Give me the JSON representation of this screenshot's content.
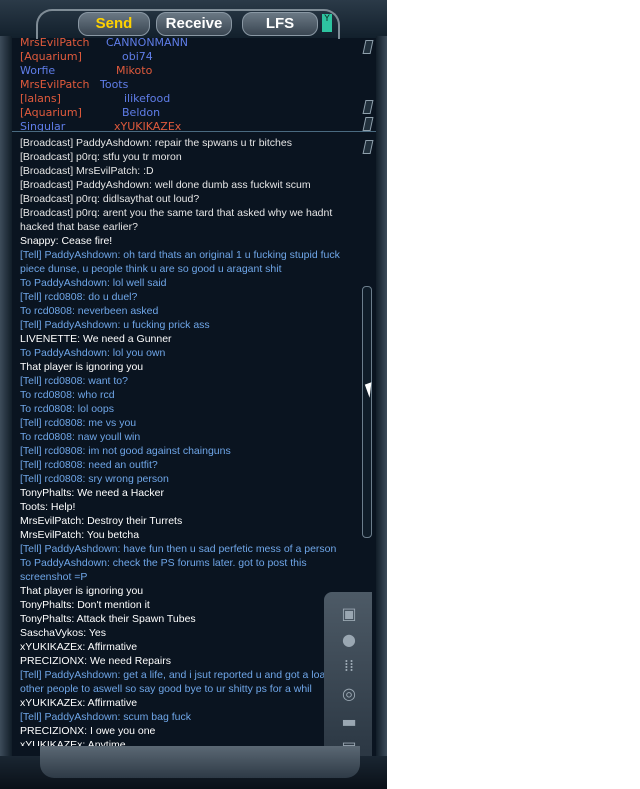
{
  "tabs": [
    {
      "label": "Send",
      "active": true
    },
    {
      "label": "Receive",
      "active": false
    },
    {
      "label": "LFS",
      "active": false
    }
  ],
  "tab_extra_glyph": "Y",
  "roster": [
    {
      "name1": "MrsEvilPatch",
      "name2": "CANNONMANN",
      "c1": "#e05a3c",
      "c2": "#5f7de8"
    },
    {
      "name1": "[Aquarium]",
      "name2": "obi74",
      "c1": "#e05a3c",
      "c2": "#5f7de8"
    },
    {
      "name1": "Worfie",
      "name2": "Mikoto",
      "c1": "#5f7de8",
      "c2": "#e05a3c"
    },
    {
      "name1": "MrsEvilPatch",
      "name2": "Toots",
      "c1": "#e05a3c",
      "c2": "#5f7de8"
    },
    {
      "name1": "[lalans]",
      "name2": "ilikefood",
      "c1": "#e05a3c",
      "c2": "#5f7de8"
    },
    {
      "name1": "[Aquarium]",
      "name2": "Beldon",
      "c1": "#e05a3c",
      "c2": "#5f7de8"
    },
    {
      "name1": "Singular",
      "name2": "xYUKIKAZEx",
      "c1": "#5f7de8",
      "c2": "#e05a3c"
    }
  ],
  "chat": [
    {
      "text": "[Broadcast] PaddyAshdown: repair the spwans u tr bitches",
      "color": "#e6e6e6"
    },
    {
      "text": "[Broadcast] p0rq: stfu you tr moron",
      "color": "#e6e6e6"
    },
    {
      "text": "[Broadcast] MrsEvilPatch: :D",
      "color": "#e6e6e6"
    },
    {
      "text": "[Broadcast] PaddyAshdown: well done dumb ass fuckwit scum",
      "color": "#e6e6e6"
    },
    {
      "text": "[Broadcast] p0rq: didlsaythat out loud?",
      "color": "#e6e6e6"
    },
    {
      "text": "[Broadcast] p0rq: arent you the same tard that asked why we hadnt hacked that base earlier?",
      "color": "#e6e6e6"
    },
    {
      "text": "Snappy: Cease fire!",
      "color": "#ffffff"
    },
    {
      "text": "[Tell] PaddyAshdown: oh tard thats an original 1 u fucking stupid fuck piece dunse, u people think u are so good u aragant shit",
      "color": "#6fa6e8"
    },
    {
      "text": "To PaddyAshdown: lol well said",
      "color": "#6fa6e8"
    },
    {
      "text": "[Tell] rcd0808: do u duel?",
      "color": "#6fa6e8"
    },
    {
      "text": "To rcd0808: neverbeen asked",
      "color": "#6fa6e8"
    },
    {
      "text": "[Tell] PaddyAshdown: u fucking prick ass",
      "color": "#6fa6e8"
    },
    {
      "text": "LIVENETTE: We need a Gunner",
      "color": "#ffffff"
    },
    {
      "text": "To PaddyAshdown: lol you own",
      "color": "#6fa6e8"
    },
    {
      "text": "That player is ignoring you",
      "color": "#ffffff"
    },
    {
      "text": "[Tell] rcd0808: want to?",
      "color": "#6fa6e8"
    },
    {
      "text": "To rcd0808: who rcd",
      "color": "#6fa6e8"
    },
    {
      "text": "To rcd0808: lol oops",
      "color": "#6fa6e8"
    },
    {
      "text": "[Tell] rcd0808: me vs you",
      "color": "#6fa6e8"
    },
    {
      "text": "To rcd0808: naw youll win",
      "color": "#6fa6e8"
    },
    {
      "text": "[Tell] rcd0808: im not good against chainguns",
      "color": "#6fa6e8"
    },
    {
      "text": "[Tell] rcd0808: need an outfit?",
      "color": "#6fa6e8"
    },
    {
      "text": "[Tell] rcd0808: sry wrong person",
      "color": "#6fa6e8"
    },
    {
      "text": "TonyPhalts: We need a Hacker",
      "color": "#ffffff"
    },
    {
      "text": "Toots: Help!",
      "color": "#ffffff"
    },
    {
      "text": "MrsEvilPatch: Destroy their Turrets",
      "color": "#ffffff"
    },
    {
      "text": "MrsEvilPatch: You betcha",
      "color": "#ffffff"
    },
    {
      "text": "[Tell] PaddyAshdown: have fun then u sad perfetic mess of a person",
      "color": "#6fa6e8"
    },
    {
      "text": "To PaddyAshdown: check the PS forums later. got to post this screenshot =P",
      "color": "#6fa6e8"
    },
    {
      "text": "That player is ignoring you",
      "color": "#ffffff"
    },
    {
      "text": "TonyPhalts: Don't mention it",
      "color": "#ffffff"
    },
    {
      "text": "TonyPhalts: Attack their Spawn Tubes",
      "color": "#ffffff"
    },
    {
      "text": "SaschaVykos: Yes",
      "color": "#ffffff"
    },
    {
      "text": "xYUKIKAZEx: Affirmative",
      "color": "#ffffff"
    },
    {
      "text": "PRECIZIONX: We need Repairs",
      "color": "#ffffff"
    },
    {
      "text": "[Tell] PaddyAshdown: get a life, and i jsut reported u and got a load of other people to aswell so say good bye to ur shitty ps for a whil",
      "color": "#6fa6e8"
    },
    {
      "text": "xYUKIKAZEx: Affirmative",
      "color": "#ffffff"
    },
    {
      "text": "[Tell] PaddyAshdown: scum bag fuck",
      "color": "#6fa6e8"
    },
    {
      "text": "PRECIZIONX: I owe you one",
      "color": "#ffffff"
    },
    {
      "text": "xYUKIKAZEx: Anytime",
      "color": "#ffffff"
    }
  ],
  "side_icons": [
    "backpack-icon",
    "person-icon",
    "group-icon",
    "globe-icon",
    "vehicle-icon",
    "book-icon"
  ]
}
